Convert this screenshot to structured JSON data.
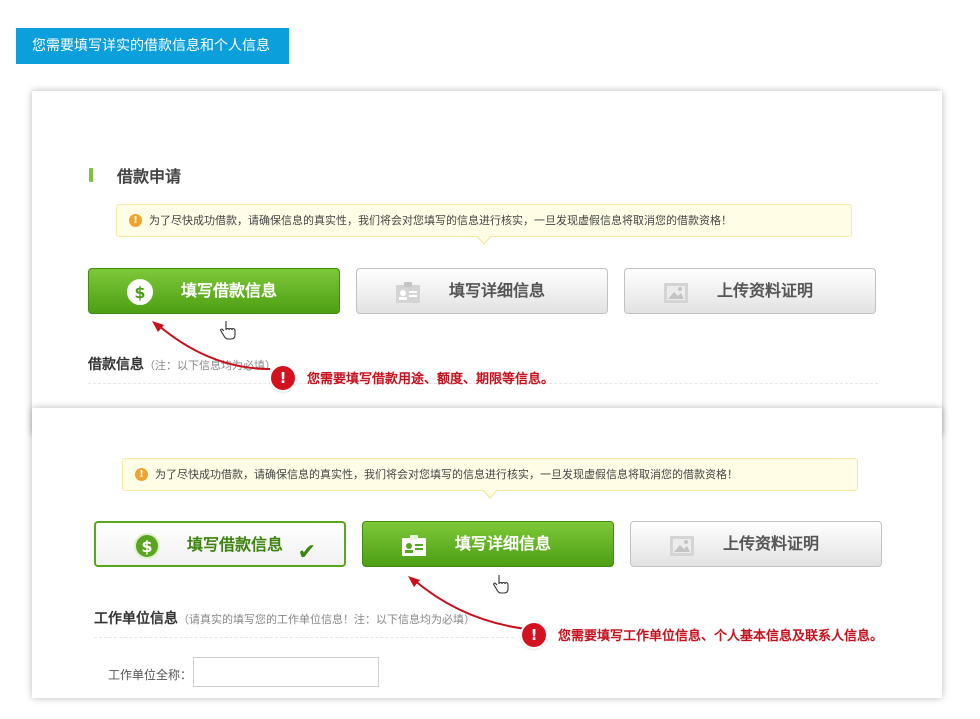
{
  "banner": {
    "text": "您需要填写详实的借款信息和个人信息"
  },
  "panel1": {
    "section_title": "借款申请",
    "notice": "为了尽快成功借款，请确保信息的真实性，我们将会对您填写的信息进行核实，一旦发现虚假信息将取消您的借款资格！",
    "steps": [
      {
        "label": "填写借款信息",
        "icon": "dollar-coin-icon",
        "state": "active"
      },
      {
        "label": "填写详细信息",
        "icon": "id-card-icon",
        "state": "inactive"
      },
      {
        "label": "上传资料证明",
        "icon": "image-icon",
        "state": "inactive"
      }
    ],
    "sub_heading": "借款信息",
    "sub_hint": "（注：以下信息均为必填）",
    "callout": "您需要填写借款用途、额度、期限等信息。"
  },
  "panel2": {
    "notice": "为了尽快成功借款，请确保信息的真实性，我们将会对您填写的信息进行核实，一旦发现虚假信息将取消您的借款资格！",
    "steps": [
      {
        "label": "填写借款信息",
        "icon": "dollar-coin-icon",
        "state": "done",
        "check": "✔"
      },
      {
        "label": "填写详细信息",
        "icon": "id-card-icon",
        "state": "active"
      },
      {
        "label": "上传资料证明",
        "icon": "image-icon",
        "state": "inactive"
      }
    ],
    "sub_heading": "工作单位信息",
    "sub_hint": "（请真实的填写您的工作单位信息！注：以下信息均为必填）",
    "callout": "您需要填写工作单位信息、个人基本信息及联系人信息。",
    "field_label": "工作单位全称：",
    "field_value": ""
  },
  "colors": {
    "banner": "#0b9fdc",
    "green": "#5aa51f",
    "alert_red": "#d4121f",
    "notice_bg": "#fffde6"
  },
  "icons": {
    "notice": "!",
    "coin": "$",
    "alert": "!"
  }
}
